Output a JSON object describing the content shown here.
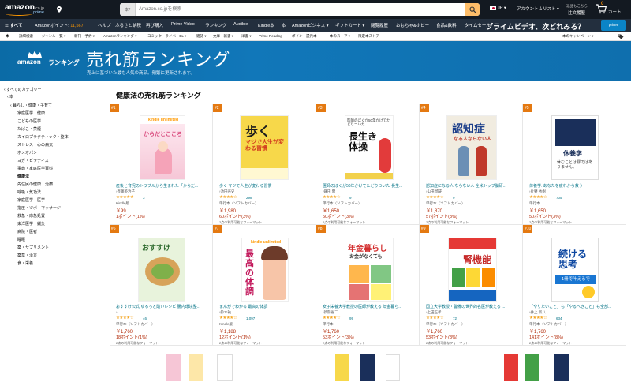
{
  "header": {
    "logo_text": "amazon",
    "logo_suffix": ".co.jp",
    "logo_prime": "prime",
    "search_category": "本",
    "search_placeholder": "Amazon.co.jpを検索",
    "language": "JP",
    "account_label": "アカウント＆リスト",
    "orders_small": "返品もこちら",
    "orders_label": "注文履歴",
    "cart_count": "0",
    "cart_label": "カート"
  },
  "nav": {
    "all_label": "すべて",
    "points_label": "Amazonポイント: ",
    "points_value": "11,567",
    "items": [
      "ヘルプ",
      "ふるさと納税",
      "再び購入",
      "Prime Video",
      "ランキング",
      "Audible",
      "Kindle本",
      "本",
      "Amazonビジネス",
      "ギフトカード",
      "閲覧履歴",
      "おもちゃ&ホビー",
      "食品&飲料",
      "タイムセール"
    ],
    "promo": "プライムビデオ、次どれみる？",
    "prime_badge": "prime"
  },
  "subnav": {
    "items": [
      "本",
      "詳細検索",
      "ジャンル一覧",
      "新刊・予約",
      "Amazonランキング",
      "コミック・ラノベ・BL",
      "雑誌",
      "文庫・新書",
      "洋書",
      "Prime Reading",
      "ポイント還元本",
      "本のストア",
      "限定本ストア"
    ],
    "campaign": "本のキャンペーン"
  },
  "banner": {
    "brand": "amazon",
    "brand_suffix": "ランキング",
    "title": "売れ筋ランキング",
    "subtitle": "売上に基づいた最も人気の商品。頻繁に更新されます。"
  },
  "sidebar": {
    "items": [
      {
        "label": "‹ すべてのカテゴリー",
        "bold": false
      },
      {
        "label": "‹ 本",
        "bold": false
      },
      {
        "label": "‹ 暮らし・健康・子育て",
        "bold": false
      },
      {
        "label": "家庭医学・健康",
        "bold": false
      },
      {
        "label": "こどもの医学",
        "bold": false
      },
      {
        "label": "たばこ・禁煙",
        "bold": false
      },
      {
        "label": "カイロプラクティック・整体",
        "bold": false
      },
      {
        "label": "ストレス・心の病気",
        "bold": false
      },
      {
        "label": "ホメオパシー",
        "bold": false
      },
      {
        "label": "ヨガ・ピラティス",
        "bold": false
      },
      {
        "label": "事典・家庭医学百科",
        "bold": false
      },
      {
        "label": "健康法",
        "bold": true
      },
      {
        "label": "先住民の健康・治療",
        "bold": false
      },
      {
        "label": "呼吸・気功法",
        "bold": false
      },
      {
        "label": "家庭医学・医学",
        "bold": false
      },
      {
        "label": "指圧・ツボ・マッサージ",
        "bold": false
      },
      {
        "label": "救急・応急処置",
        "bold": false
      },
      {
        "label": "東洋医学・鍼灸",
        "bold": false
      },
      {
        "label": "病院・医者",
        "bold": false
      },
      {
        "label": "睡眠",
        "bold": false
      },
      {
        "label": "薬・サプリメント",
        "bold": false
      },
      {
        "label": "薬草・漢方",
        "bold": false
      },
      {
        "label": "食・栄養",
        "bold": false
      }
    ]
  },
  "main": {
    "title": "健康法の売れ筋ランキング",
    "books": [
      {
        "rank": "#1",
        "title": "産後と育児のトラブルから生まれた「からだ...",
        "author": "›斉藤英治子",
        "stars": "★★★★★",
        "reviews": "3",
        "format": "Kindle版",
        "price": "￥99",
        "points": "1ポイント(1%)",
        "other": ""
      },
      {
        "rank": "#2",
        "title": "歩く マジで人生が変わる習慣",
        "author": "›池田光史",
        "stars": "★★★★☆",
        "reviews": "298",
        "format": "単行本（ソフトカバー）",
        "price": "￥1,980",
        "points": "60ポイント(3%)",
        "other": "2点の利用可能なフォーマット"
      },
      {
        "rank": "#3",
        "title": "医師のぼくが50年かけてたどりついた 長生...",
        "author": "›鎌田 實",
        "stars": "★★★★☆",
        "reviews": "9",
        "format": "単行本（ソフトカバー）",
        "price": "￥1,650",
        "points": "50ポイント(3%)",
        "other": "2点の利用可能なフォーマット"
      },
      {
        "rank": "#4",
        "title": "認知症になる人 ならない人 全米トップ脳研...",
        "author": "›山田 悠史",
        "stars": "★★★★☆",
        "reviews": "9",
        "format": "単行本（ソフトカバー）",
        "price": "￥1,870",
        "points": "57ポイント(3%)",
        "other": "2点の利用可能なフォーマット"
      },
      {
        "rank": "#5",
        "title": "体養学: あなたを疲れから救う",
        "author": "›片野 秀樹",
        "stars": "★★★★☆",
        "reviews": "705",
        "format": "単行本",
        "price": "￥1,650",
        "points": "50ポイント(3%)",
        "other": "2点の利用可能なフォーマット"
      },
      {
        "rank": "#6",
        "title": "おすすけ公式 ゆるっと酸いレシピ 腸内環境整...",
        "author": "›",
        "stars": "★★★★☆",
        "reviews": "46",
        "format": "単行本（ソフトカバー）",
        "price": "￥1,760",
        "points": "18ポイント(1%)",
        "other": "2点の利用可能なフォーマット"
      },
      {
        "rank": "#7",
        "title": "まんがでわかる 最高の体調",
        "author": "›鈴木祐",
        "stars": "★★★★☆",
        "reviews": "1,097",
        "format": "Kindle版",
        "price": "￥1,188",
        "points": "12ポイント(1%)",
        "other": "2点の利用可能なフォーマット"
      },
      {
        "rank": "#8",
        "title": "女子栄養大学教授の医師が教える 年金暮ら...",
        "author": "›新開省二",
        "stars": "★★★★☆",
        "reviews": "99",
        "format": "単行本",
        "price": "￥1,760",
        "points": "53ポイント(3%)",
        "other": "2点の利用可能なフォーマット"
      },
      {
        "rank": "#9",
        "title": "国立大学教授・警備の世界的名医が教える ...",
        "author": "›上田正孝",
        "stars": "★★★★☆",
        "reviews": "72",
        "format": "単行本（ソフトカバー）",
        "price": "￥1,760",
        "points": "53ポイント(3%)",
        "other": "2点の利用可能なフォーマット"
      },
      {
        "rank": "#10",
        "title": "「やりたいこと」も「やるべきこと」も全部...",
        "author": "›井上 新八",
        "stars": "★★★★☆",
        "reviews": "634",
        "format": "単行本（ソフトカバー）",
        "price": "￥1,760",
        "points": "141ポイント(8%)",
        "other": "2点の利用可能なフォーマット"
      }
    ]
  },
  "covers": {
    "c1_brand": "kindle unlimited",
    "c1_title": "からだとこころ",
    "c2_title": "歩く",
    "c2_sub": "マジで人生が変わる習慣",
    "c3_title": "長生き体操",
    "c3_top": "医師のぼくが50年かけてたどりついた",
    "c4_title": "認知症",
    "c4_sub": "なる人ならない人",
    "c5_title": "休養学",
    "c5_sub": "休むことは罪ではありません。",
    "c6_title": "おすすけ",
    "c7_brand": "kindle unlimited",
    "c7_title": "最高の体調",
    "c8_title": "年金暮らし",
    "c8_sub": "お金がなくても",
    "c9_title": "腎機能",
    "c10_title": "続ける思考",
    "c10_sub": "1冊で叶えるで"
  },
  "colors": {
    "header_bg": "#131921",
    "nav_bg": "#232f3e",
    "banner_bg": "#1177b9",
    "rank_badge": "#e47911",
    "link": "#007185",
    "price": "#b12704",
    "star": "#f5a623"
  }
}
